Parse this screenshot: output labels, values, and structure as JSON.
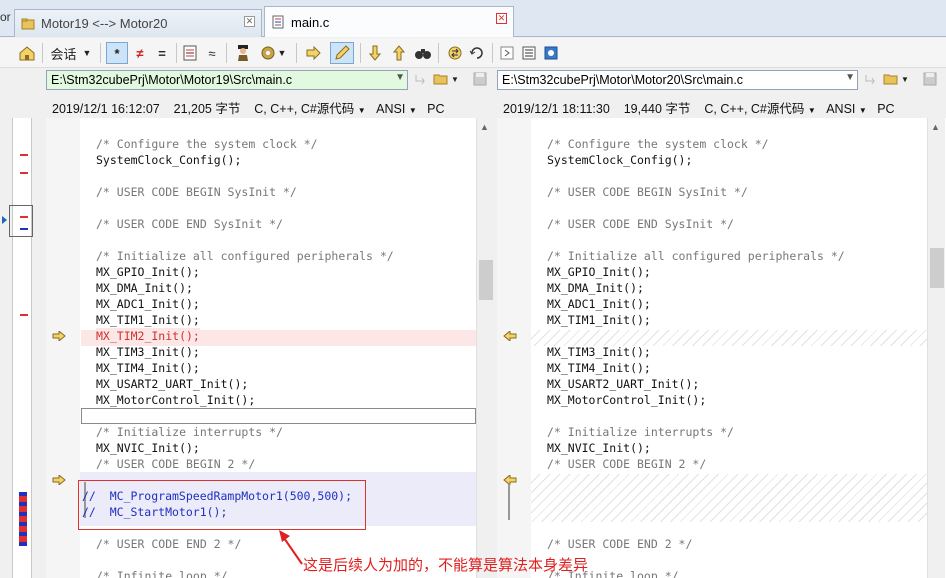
{
  "tabs": [
    {
      "label": "Motor19 <--> Motor20",
      "active": false
    },
    {
      "label": "main.c",
      "active": true
    }
  ],
  "left_edge_text": "or",
  "toolbar": {
    "session_label": "会话",
    "all_symbol": "*",
    "diff_symbol": "≠",
    "same_symbol": "=",
    "approx_symbol": "≈"
  },
  "left": {
    "path": "E:\\Stm32cubePrj\\Motor\\Motor19\\Src\\main.c",
    "date": "2019/12/1 16:12:07",
    "size": "21,205 字节",
    "format": "C, C++, C#源代码",
    "encoding": "ANSI",
    "line_ending": "PC"
  },
  "right": {
    "path": "E:\\Stm32cubePrj\\Motor\\Motor20\\Src\\main.c",
    "date": "2019/12/1 18:11:30",
    "size": "19,440 字节",
    "format": "C, C++, C#源代码",
    "encoding": "ANSI",
    "line_ending": "PC"
  },
  "code_left": [
    {
      "text": "/* Configure the system clock */",
      "kind": "comment"
    },
    {
      "text": "SystemClock_Config();",
      "kind": "plain"
    },
    {
      "text": "",
      "kind": "plain"
    },
    {
      "text": "/* USER CODE BEGIN SysInit */",
      "kind": "comment"
    },
    {
      "text": "",
      "kind": "plain"
    },
    {
      "text": "/* USER CODE END SysInit */",
      "kind": "comment"
    },
    {
      "text": "",
      "kind": "plain"
    },
    {
      "text": "/* Initialize all configured peripherals */",
      "kind": "comment"
    },
    {
      "text": "MX_GPIO_Init();",
      "kind": "plain"
    },
    {
      "text": "MX_DMA_Init();",
      "kind": "plain"
    },
    {
      "text": "MX_ADC1_Init();",
      "kind": "plain"
    },
    {
      "text": "MX_TIM1_Init();",
      "kind": "plain"
    },
    {
      "text": "MX_TIM2_Init();",
      "kind": "removed"
    },
    {
      "text": "MX_TIM3_Init();",
      "kind": "plain"
    },
    {
      "text": "MX_TIM4_Init();",
      "kind": "plain"
    },
    {
      "text": "MX_USART2_UART_Init();",
      "kind": "plain"
    },
    {
      "text": "MX_MotorControl_Init();",
      "kind": "plain"
    },
    {
      "text": "",
      "kind": "plain"
    },
    {
      "text": "/* Initialize interrupts */",
      "kind": "comment"
    },
    {
      "text": "MX_NVIC_Init();",
      "kind": "plain"
    },
    {
      "text": "/* USER CODE BEGIN 2 */",
      "kind": "comment"
    },
    {
      "text": "",
      "kind": "plain"
    },
    {
      "text": "//  MC_ProgramSpeedRampMotor1(500,500);",
      "kind": "added"
    },
    {
      "text": "//  MC_StartMotor1();",
      "kind": "added"
    },
    {
      "text": "",
      "kind": "plain"
    },
    {
      "text": "/* USER CODE END 2 */",
      "kind": "comment"
    },
    {
      "text": "",
      "kind": "plain"
    },
    {
      "text": "/* Infinite loop */",
      "kind": "comment"
    }
  ],
  "code_right": [
    {
      "text": "/* Configure the system clock */",
      "kind": "comment"
    },
    {
      "text": "SystemClock_Config();",
      "kind": "plain"
    },
    {
      "text": "",
      "kind": "plain"
    },
    {
      "text": "/* USER CODE BEGIN SysInit */",
      "kind": "comment"
    },
    {
      "text": "",
      "kind": "plain"
    },
    {
      "text": "/* USER CODE END SysInit */",
      "kind": "comment"
    },
    {
      "text": "",
      "kind": "plain"
    },
    {
      "text": "/* Initialize all configured peripherals */",
      "kind": "comment"
    },
    {
      "text": "MX_GPIO_Init();",
      "kind": "plain"
    },
    {
      "text": "MX_DMA_Init();",
      "kind": "plain"
    },
    {
      "text": "MX_ADC1_Init();",
      "kind": "plain"
    },
    {
      "text": "MX_TIM1_Init();",
      "kind": "plain"
    },
    {
      "text": "",
      "kind": "gap"
    },
    {
      "text": "MX_TIM3_Init();",
      "kind": "plain"
    },
    {
      "text": "MX_TIM4_Init();",
      "kind": "plain"
    },
    {
      "text": "MX_USART2_UART_Init();",
      "kind": "plain"
    },
    {
      "text": "MX_MotorControl_Init();",
      "kind": "plain"
    },
    {
      "text": "",
      "kind": "plain"
    },
    {
      "text": "/* Initialize interrupts */",
      "kind": "comment"
    },
    {
      "text": "MX_NVIC_Init();",
      "kind": "plain"
    },
    {
      "text": "/* USER CODE BEGIN 2 */",
      "kind": "comment"
    },
    {
      "text": "",
      "kind": "gap"
    },
    {
      "text": "",
      "kind": "gap"
    },
    {
      "text": "",
      "kind": "gap"
    },
    {
      "text": "",
      "kind": "plain"
    },
    {
      "text": "/* USER CODE END 2 */",
      "kind": "comment"
    },
    {
      "text": "",
      "kind": "plain"
    },
    {
      "text": "/* Infinite loop */",
      "kind": "comment"
    }
  ],
  "annotation": "这是后续人为加的，不能算是算法本身差异",
  "colors": {
    "removed_text": "#d03030",
    "added_text": "#2030c0",
    "annotation": "#e02020",
    "removed_bg": "#fde6e6",
    "added_bg": "#ebebfa"
  }
}
